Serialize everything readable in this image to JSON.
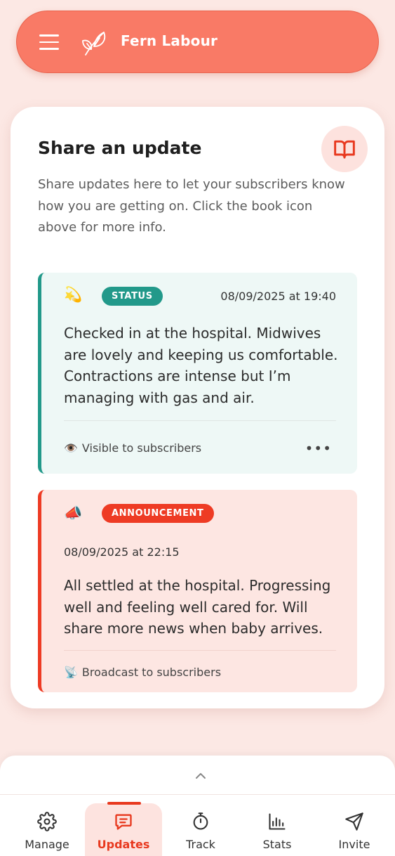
{
  "header": {
    "brand": "Fern Labour"
  },
  "card": {
    "title": "Share an update",
    "description": "Share updates here to let your subscribers know how you are getting on. Click the book icon above for more info."
  },
  "updates": [
    {
      "emoji": "💫",
      "badge": "STATUS",
      "date": "08/09/2025 at 19:40",
      "text": "Checked in at the hospital. Midwives are lovely and keeping us comfortable. Contractions are intense but I’m managing with gas and air.",
      "footer_emoji": "👁️",
      "footer": "Visible to subscribers",
      "more": "•••"
    },
    {
      "emoji": "📣",
      "badge": "ANNOUNCEMENT",
      "date": "08/09/2025 at 22:15",
      "text": "All settled at the hospital. Progressing well and feeling well cared for. Will share more news when baby arrives.",
      "footer_emoji": "📡",
      "footer": "Broadcast to subscribers"
    }
  ],
  "tabs": [
    {
      "label": "Manage",
      "icon": "gear-icon"
    },
    {
      "label": "Updates",
      "icon": "message-icon"
    },
    {
      "label": "Track",
      "icon": "stopwatch-icon"
    },
    {
      "label": "Stats",
      "icon": "chart-icon"
    },
    {
      "label": "Invite",
      "icon": "send-icon"
    }
  ],
  "colors": {
    "brand": "#f97a66",
    "accent": "#e8391f",
    "status": "#22998a",
    "announcement": "#ee3b24"
  }
}
